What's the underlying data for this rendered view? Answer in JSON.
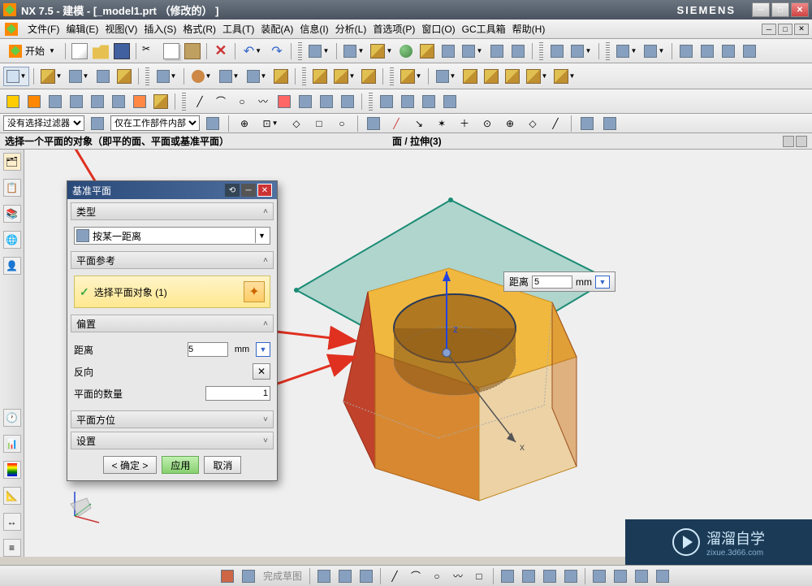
{
  "title": "NX 7.5 - 建模 - [_model1.prt （修改的） ]",
  "brand": "SIEMENS",
  "menu": [
    "文件(F)",
    "编辑(E)",
    "视图(V)",
    "插入(S)",
    "格式(R)",
    "工具(T)",
    "装配(A)",
    "信息(I)",
    "分析(L)",
    "首选项(P)",
    "窗口(O)",
    "GC工具箱",
    "帮助(H)"
  ],
  "start": "开始",
  "filters": {
    "left": "没有选择过滤器",
    "right": "仅在工作部件内部"
  },
  "prompt_left": "选择一个平面的对象（即平的面、平面或基准平面）",
  "prompt_right": "面 / 拉伸(3)",
  "float": {
    "label": "距离",
    "value": "5",
    "unit": "mm"
  },
  "dialog": {
    "title": "基准平面",
    "type_section": "类型",
    "type_value": "按某一距离",
    "ref_section": "平面参考",
    "select_label": "选择平面对象 (1)",
    "offset_section": "偏置",
    "distance_label": "距离",
    "distance_value": "5",
    "distance_unit": "mm",
    "reverse_label": "反向",
    "count_label": "平面的数量",
    "count_value": "1",
    "orient_section": "平面方位",
    "settings_section": "设置",
    "ok": "< 确定 >",
    "apply": "应用",
    "cancel": "取消"
  },
  "bottom_label": "完成草图",
  "watermark": {
    "main": "溜溜自学",
    "sub": "zixue.3d66.com"
  },
  "axis": {
    "x": "x",
    "z": "z"
  }
}
